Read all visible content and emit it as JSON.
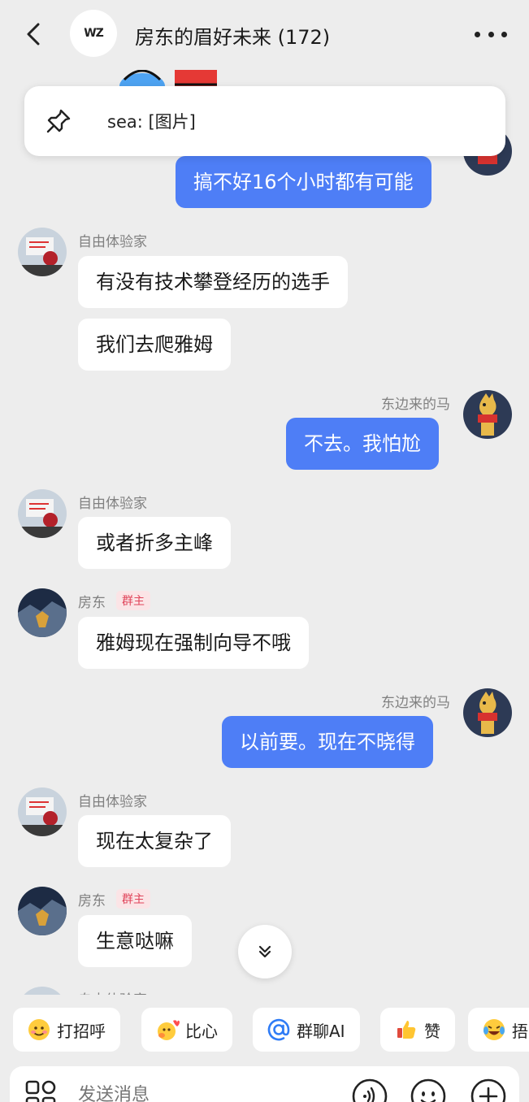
{
  "header": {
    "title": "房东的眉好未来 (172)",
    "group_logo_text": "WZ",
    "back_icon": "chevron-left-icon",
    "more_icon": "more-dots-icon"
  },
  "pinned": {
    "text": "sea: [图片]",
    "icon": "pin-icon"
  },
  "messages": [
    {
      "side": "out",
      "text": "搞不好16个小时都有可能"
    },
    {
      "side": "in",
      "sender": "自由体验家",
      "text": "有没有技术攀登经历的选手"
    },
    {
      "side": "in",
      "text": "我们去爬雅姆"
    },
    {
      "side": "out",
      "sender": "东边来的马",
      "text": "不去。我怕尬"
    },
    {
      "side": "in",
      "sender": "自由体验家",
      "text": "或者折多主峰"
    },
    {
      "side": "in",
      "sender": "房东",
      "badge": "群主",
      "text": "雅姆现在强制向导不哦"
    },
    {
      "side": "out",
      "sender": "东边来的马",
      "text": "以前要。现在不晓得"
    },
    {
      "side": "in",
      "sender": "自由体验家",
      "text": "现在太复杂了"
    },
    {
      "side": "in",
      "sender": "房东",
      "badge": "群主",
      "text": "生意哒嘛"
    },
    {
      "side": "in",
      "sender": "自由体验家",
      "text": ""
    }
  ],
  "quick_replies": [
    {
      "label": "打招呼",
      "icon": "wave-emoji-icon"
    },
    {
      "label": "比心",
      "icon": "heart-hands-emoji-icon"
    },
    {
      "label": "群聊AI",
      "icon": "at-icon"
    },
    {
      "label": "赞",
      "icon": "thumbs-up-icon"
    },
    {
      "label": "捂",
      "icon": "laugh-cry-emoji-icon"
    }
  ],
  "input": {
    "placeholder": "发送消息"
  },
  "colors": {
    "background": "#ededed",
    "outgoing_bubble": "#4e7ef6",
    "incoming_bubble": "#ffffff",
    "owner_badge_text": "#e0445a",
    "owner_badge_bg": "#fbe4e6"
  }
}
